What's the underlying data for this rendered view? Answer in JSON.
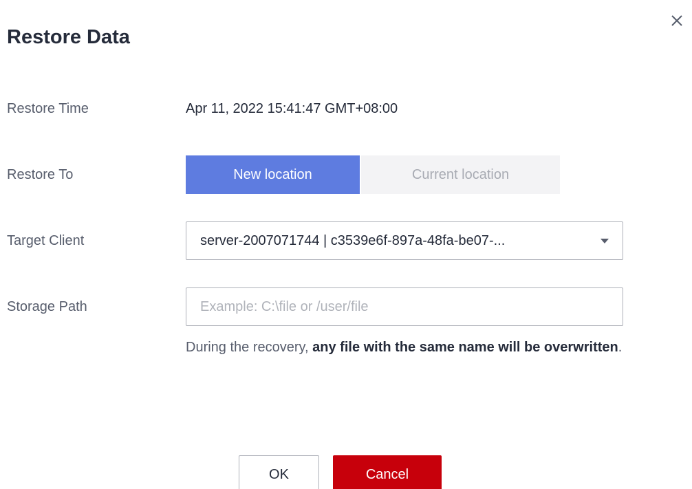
{
  "dialog": {
    "title": "Restore Data",
    "close_icon": "close-icon"
  },
  "form": {
    "restore_time": {
      "label": "Restore Time",
      "value": "Apr 11, 2022 15:41:47 GMT+08:00"
    },
    "restore_to": {
      "label": "Restore To",
      "options": [
        "New location",
        "Current location"
      ],
      "selected": "New location"
    },
    "target_client": {
      "label": "Target Client",
      "value": "server-2007071744 | c3539e6f-897a-48fa-be07-...",
      "dropdown_icon": "caret-down-icon"
    },
    "storage_path": {
      "label": "Storage Path",
      "value": "",
      "placeholder": "Example: C:\\file or /user/file"
    },
    "hint": {
      "prefix": "During the recovery, ",
      "emphasis": "any file with the same name will be overwritten",
      "suffix": "."
    }
  },
  "footer": {
    "ok_label": "OK",
    "cancel_label": "Cancel"
  },
  "colors": {
    "primary": "#5e7ce0",
    "danger": "#c7000b",
    "segment_inactive_bg": "#f3f3f5",
    "segment_inactive_text": "#a8abb3",
    "border": "#adb0b8",
    "label_text": "#575d6c",
    "main_text": "#252b3a"
  }
}
